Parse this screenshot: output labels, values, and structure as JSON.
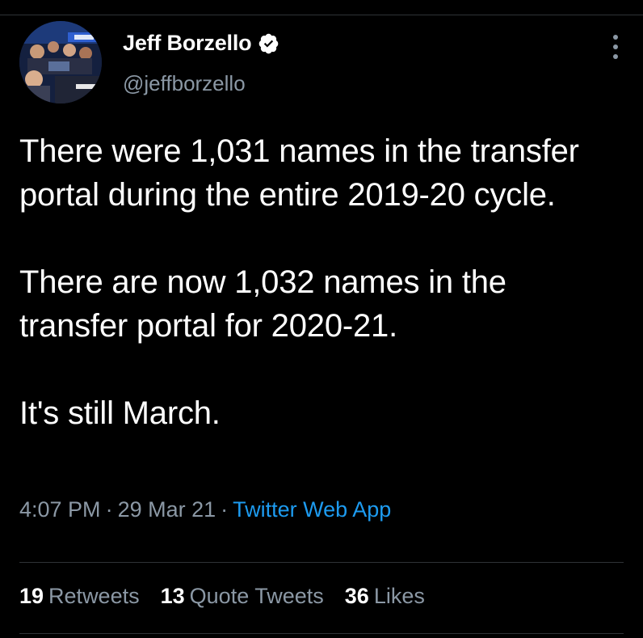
{
  "author": {
    "display_name": "Jeff Borzello",
    "handle": "@jeffborzello",
    "verified": true,
    "avatar_icon": "profile-photo"
  },
  "tweet": {
    "paragraphs": [
      "There were 1,031 names in the transfer portal during the entire 2019-20 cycle.",
      "There are now 1,032 names in the transfer portal for 2020-21.",
      "It's still March."
    ],
    "time": "4:07 PM",
    "separator": "·",
    "date": "29 Mar 21",
    "source": "Twitter Web App"
  },
  "stats": {
    "retweets_count": "19",
    "retweets_label": "Retweets",
    "quotes_count": "13",
    "quotes_label": "Quote Tweets",
    "likes_count": "36",
    "likes_label": "Likes"
  },
  "colors": {
    "background": "#000000",
    "text": "#ffffff",
    "secondary": "#8b98a5",
    "link": "#1d9bf0",
    "divider": "#2f3336"
  },
  "icons": {
    "verified": "verified-badge-icon",
    "more": "more-vertical-icon"
  }
}
